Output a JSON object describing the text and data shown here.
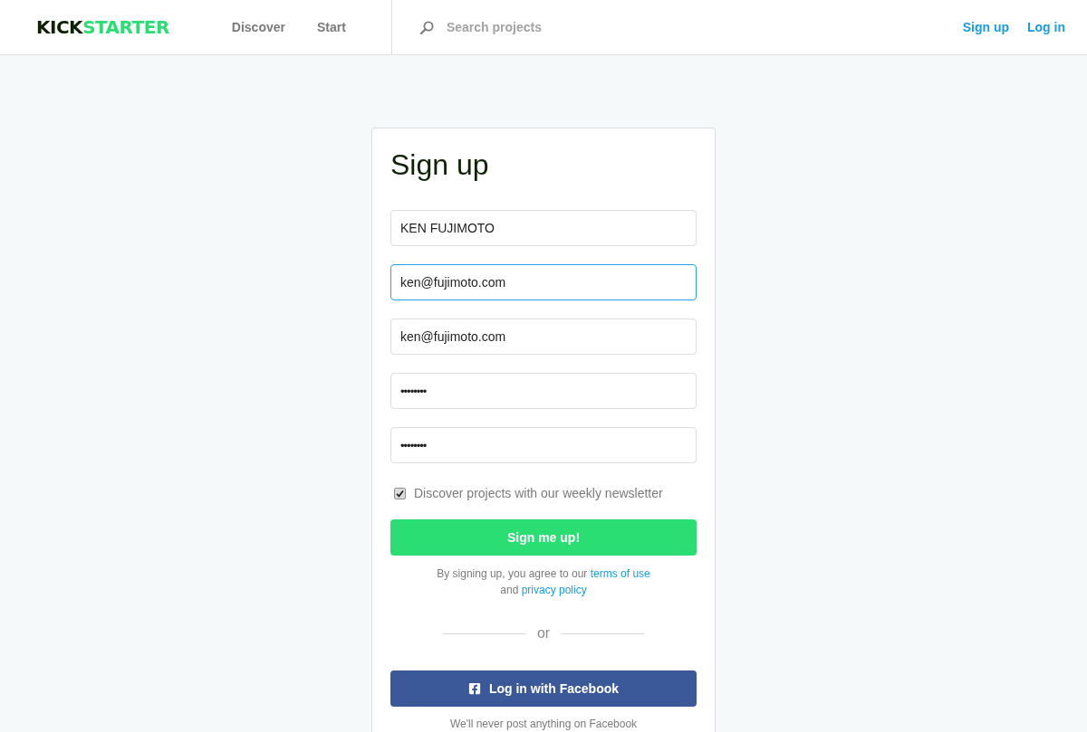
{
  "header": {
    "logo": [
      "KICK",
      "STARTER"
    ],
    "nav": [
      "Discover",
      "Start"
    ],
    "search": {
      "placeholder": "Search projects"
    },
    "account_links": [
      "Sign up",
      "Log in"
    ]
  },
  "form": {
    "title": "Sign up",
    "fields": [
      {
        "kind": "text",
        "value": "KEN FUJIMOTO",
        "focused": false
      },
      {
        "kind": "text",
        "value": "ken@fujimoto.com",
        "focused": true
      },
      {
        "kind": "text",
        "value": "ken@fujimoto.com",
        "focused": false
      },
      {
        "kind": "password",
        "value": "••••••••",
        "focused": false
      },
      {
        "kind": "password",
        "value": "••••••••",
        "focused": false
      }
    ],
    "newsletter": {
      "label": "Discover projects with our weekly newsletter",
      "checked": true
    },
    "submit": "Sign me up!",
    "terms": {
      "before": "By signing up, you agree to our",
      "terms_link": "terms of use",
      "middle": "and",
      "privacy_link": "privacy policy"
    },
    "divider": "or",
    "facebook_button": "Log in with Facebook",
    "facebook_note": "We'll never post anything on Facebook"
  }
}
